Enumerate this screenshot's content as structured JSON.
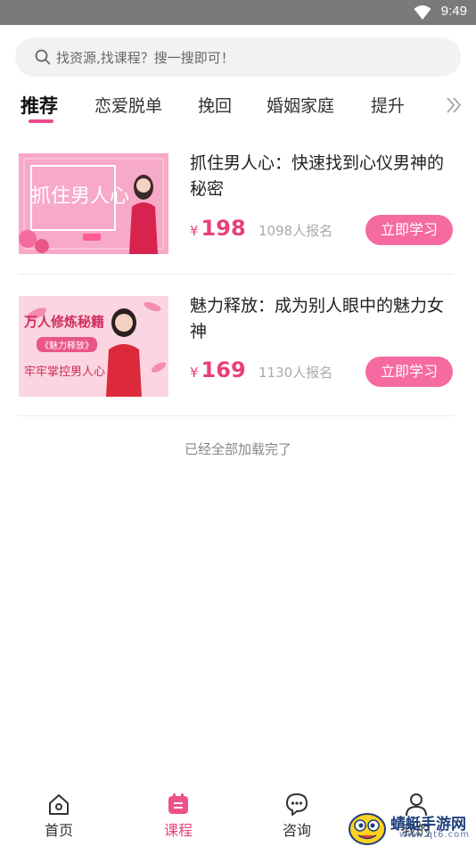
{
  "status_bar": {
    "time": "9:49"
  },
  "search": {
    "placeholder": "找资源,找课程？搜一搜即可！"
  },
  "tabs": [
    {
      "label": "推荐",
      "active": true
    },
    {
      "label": "恋爱脱单"
    },
    {
      "label": "挽回"
    },
    {
      "label": "婚姻家庭"
    },
    {
      "label": "提升"
    }
  ],
  "courses": [
    {
      "title": "抓住男人心：快速找到心仪男神的秘密",
      "currency": "¥",
      "price": "198",
      "enrolled": "1098人报名",
      "button": "立即学习",
      "thumb_text": "抓住男人心"
    },
    {
      "title": "魅力释放：成为别人眼中的魅力女神",
      "currency": "¥",
      "price": "169",
      "enrolled": "1130人报名",
      "button": "立即学习",
      "thumb_text_1": "万人修炼秘籍",
      "thumb_text_2": "《魅力释放》",
      "thumb_text_3": "牢牢掌控男人心"
    }
  ],
  "end_text": "已经全部加载完了",
  "bottom_nav": [
    {
      "label": "首页",
      "icon": "home-icon"
    },
    {
      "label": "课程",
      "icon": "calendar-icon",
      "active": true
    },
    {
      "label": "咨询",
      "icon": "chat-icon"
    },
    {
      "label": "我的",
      "icon": "user-icon"
    }
  ],
  "watermark": {
    "text": "蜻蜓手游网",
    "url": "www.qt6.com"
  },
  "colors": {
    "accent": "#f04a8a",
    "price": "#e8407a",
    "button": "#f56aa0",
    "status_bar": "#7a7a7a"
  }
}
